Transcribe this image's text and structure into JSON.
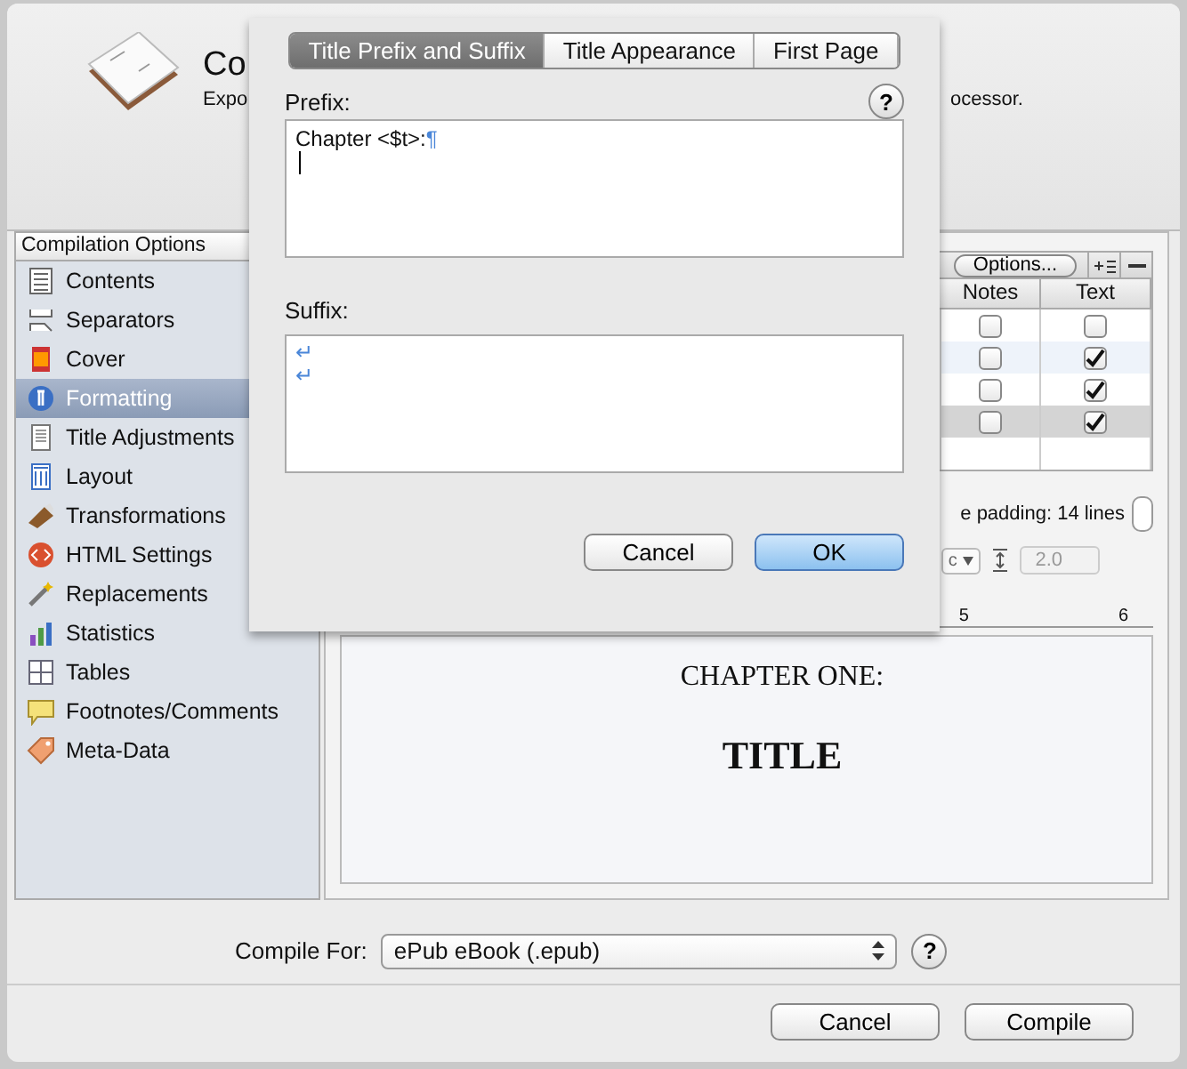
{
  "window": {
    "title": "Co",
    "subtitle_start": "Expo",
    "subtitle_end": "ocessor."
  },
  "sidebar": {
    "title": "Compilation Options",
    "items": [
      {
        "label": "Contents",
        "kind": "list",
        "selected": false
      },
      {
        "label": "Separators",
        "kind": "separator",
        "selected": false
      },
      {
        "label": "Cover",
        "kind": "cover",
        "selected": false
      },
      {
        "label": "Formatting",
        "kind": "formatting",
        "selected": true
      },
      {
        "label": "Title Adjustments",
        "kind": "page",
        "selected": false
      },
      {
        "label": "Layout",
        "kind": "layout",
        "selected": false
      },
      {
        "label": "Transformations",
        "kind": "transform",
        "selected": false
      },
      {
        "label": "HTML Settings",
        "kind": "html",
        "selected": false
      },
      {
        "label": "Replacements",
        "kind": "replace",
        "selected": false
      },
      {
        "label": "Statistics",
        "kind": "stats",
        "selected": false
      },
      {
        "label": "Tables",
        "kind": "table",
        "selected": false
      },
      {
        "label": "Footnotes/Comments",
        "kind": "note",
        "selected": false
      },
      {
        "label": "Meta-Data",
        "kind": "tag",
        "selected": false
      }
    ]
  },
  "section_table": {
    "options_button": "Options...",
    "columns": [
      "Notes",
      "Text"
    ],
    "rows": [
      {
        "notes": false,
        "text": false,
        "selected": false
      },
      {
        "notes": false,
        "text": true,
        "selected": false
      },
      {
        "notes": false,
        "text": true,
        "selected": false
      },
      {
        "notes": false,
        "text": true,
        "selected": true
      }
    ]
  },
  "padding_label": "e padding: 14 lines",
  "format_popup": "c",
  "line_spacing": "2.0",
  "ruler_labels": [
    "5",
    "6"
  ],
  "preview": {
    "heading": "CHAPTER ONE:",
    "title": "TITLE"
  },
  "compile_for": {
    "label": "Compile For:",
    "value": "ePub eBook (.epub)",
    "help": "?"
  },
  "buttons": [
    {
      "label": "Cancel",
      "default": false
    },
    {
      "label": "Compile",
      "default": false
    }
  ],
  "sheet": {
    "tabs": [
      {
        "label": "Title Prefix and Suffix",
        "selected": true
      },
      {
        "label": "Title Appearance",
        "selected": false
      },
      {
        "label": "First Page",
        "selected": false
      }
    ],
    "help": "?",
    "prefix_label": "Prefix:",
    "prefix_text": "Chapter <$t>:",
    "prefix_mark": "¶",
    "suffix_label": "Suffix:",
    "suffix_marks": [
      "↵",
      "↵"
    ],
    "buttons": [
      {
        "label": "Cancel",
        "default": false
      },
      {
        "label": "OK",
        "default": true
      }
    ]
  }
}
